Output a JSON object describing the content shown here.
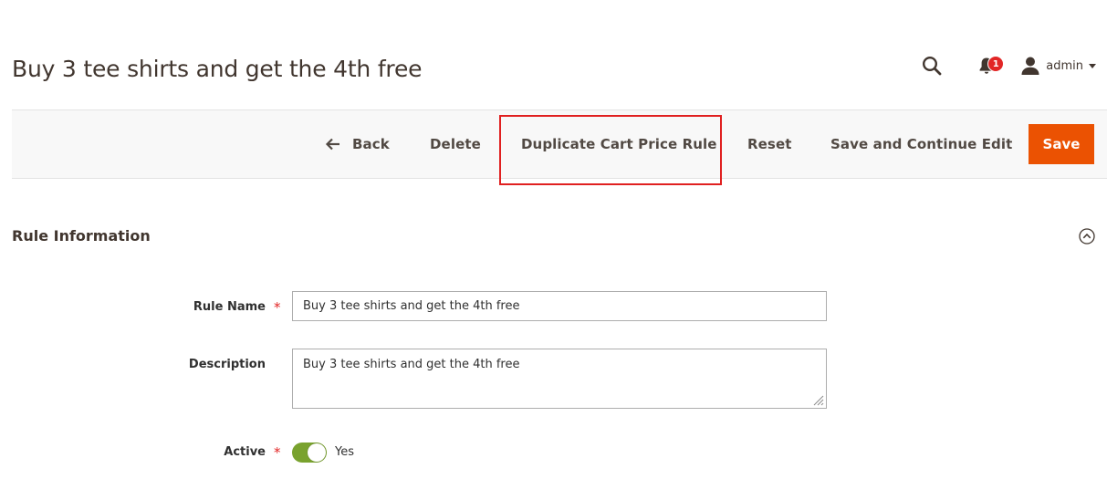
{
  "header": {
    "title": "Buy 3 tee shirts and get the 4th free",
    "notifications_count": "1",
    "user_name": "admin",
    "icons": {
      "search": "search-icon",
      "notifications": "bell-icon",
      "user": "user-icon",
      "menu": "caret-down-icon"
    }
  },
  "toolbar": {
    "back_label": "Back",
    "delete_label": "Delete",
    "duplicate_label": "Duplicate Cart Price Rule",
    "reset_label": "Reset",
    "save_continue_label": "Save and Continue Edit",
    "save_label": "Save",
    "highlighted_button": "Duplicate Cart Price Rule"
  },
  "section": {
    "title": "Rule Information"
  },
  "form": {
    "rule_name": {
      "label": "Rule Name",
      "required_marker": "*",
      "value": "Buy 3 tee shirts and get the 4th free"
    },
    "description": {
      "label": "Description",
      "value": "Buy 3 tee shirts and get the 4th free"
    },
    "active": {
      "label": "Active",
      "required_marker": "*",
      "state": "on",
      "value_label": "Yes"
    }
  },
  "colors": {
    "primary_action": "#eb5202",
    "highlight": "#e02020",
    "toggle_on": "#79a22e",
    "badge": "#e22626",
    "required": "#e22626"
  }
}
